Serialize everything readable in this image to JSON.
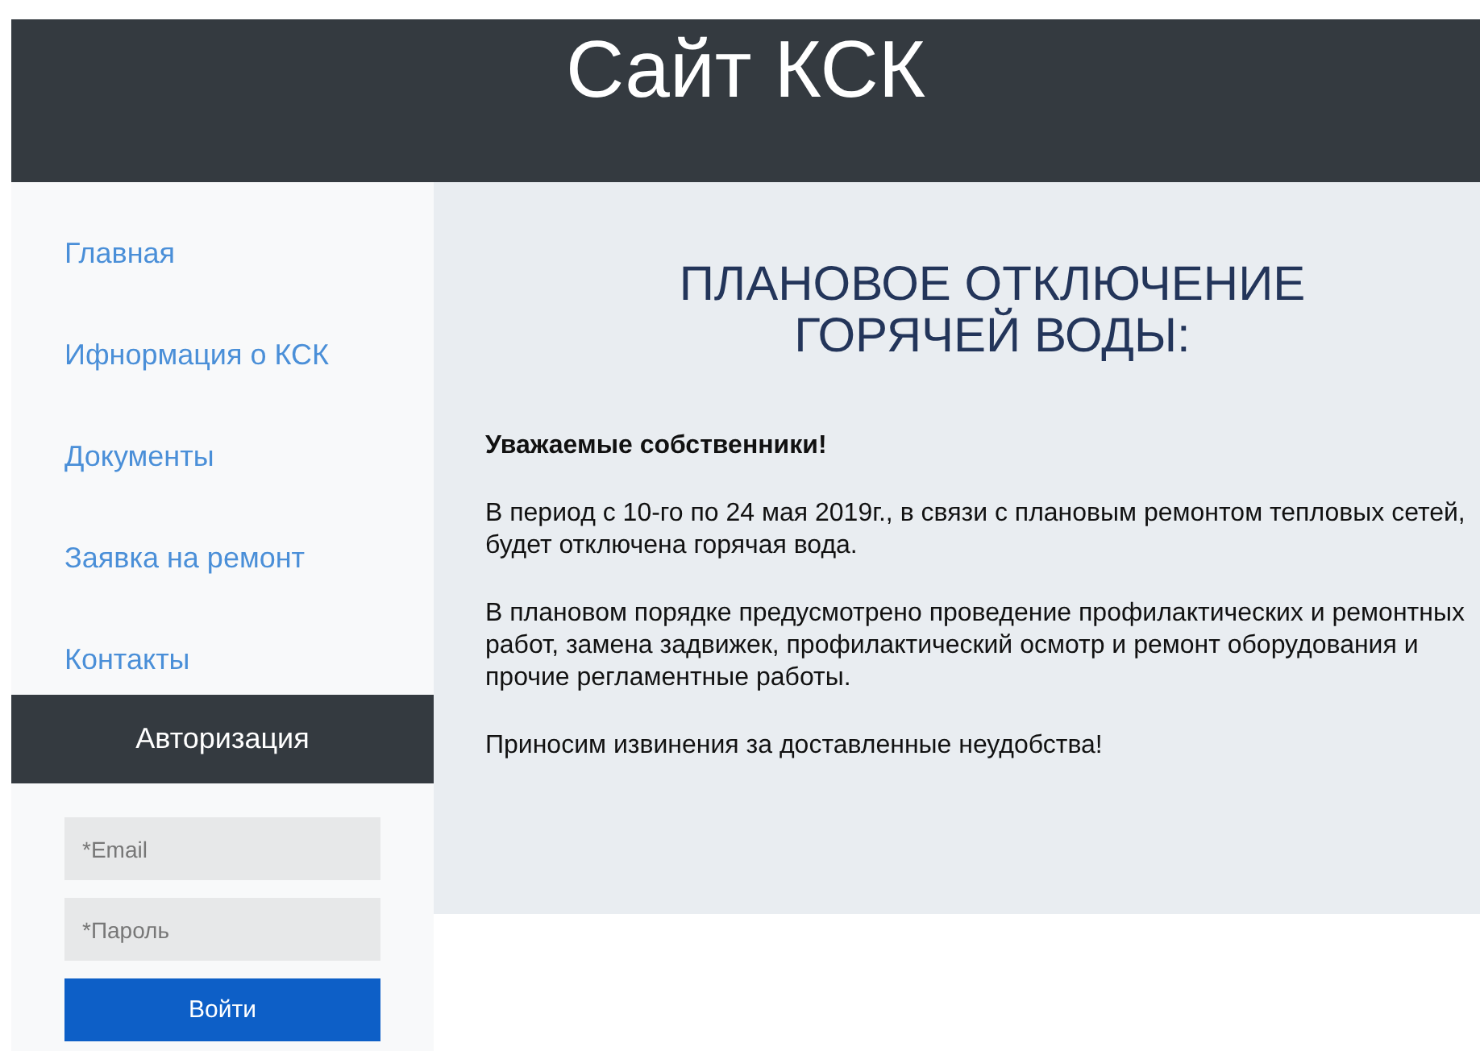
{
  "header": {
    "title": "Сайт КСК"
  },
  "sidebar": {
    "items": [
      {
        "label": "Главная"
      },
      {
        "label": "Ифнормация о КСК"
      },
      {
        "label": "Документы"
      },
      {
        "label": "Заявка на ремонт"
      },
      {
        "label": "Контакты"
      }
    ]
  },
  "login": {
    "title": "Авторизация",
    "email": {
      "placeholder": "*Email"
    },
    "password": {
      "placeholder": "*Пароль"
    },
    "button": "Войти"
  },
  "article": {
    "heading_lines": [
      "ПЛАНОВОЕ ОТКЛЮЧЕНИЕ",
      "ГОРЯЧЕЙ ВОДЫ:"
    ],
    "greeting": "Уважаемые собственники!",
    "paragraphs": [
      "В период с 10-го по 24 мая 2019г., в связи с плановым ремонтом тепловых сетей, будет отключена горячая вода.",
      "В плановом порядке предусмотрено проведение профилактических и ремонтных работ, замена задвижек, профилактический осмотр и ремонт оборудования и прочие регламентные работы.",
      "Приносим извинения за доставленные неудобства!"
    ]
  }
}
